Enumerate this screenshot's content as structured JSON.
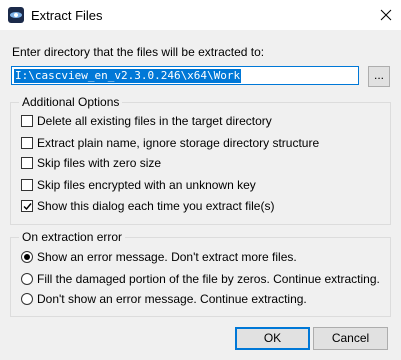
{
  "window": {
    "title": "Extract Files",
    "icon": "cascview-app-icon",
    "close_icon": "close-icon"
  },
  "directory": {
    "label": "Enter directory that the files will be extracted to:",
    "value": "I:\\cascview_en_v2.3.0.246\\x64\\Work",
    "browse_label": "..."
  },
  "additional_options": {
    "title": "Additional Options",
    "items": [
      {
        "label": "Delete all existing files in the target directory",
        "checked": false
      },
      {
        "label": "Extract plain name, ignore storage directory structure",
        "checked": false
      },
      {
        "label": "Skip files with zero size",
        "checked": false
      },
      {
        "label": "Skip files encrypted with an unknown key",
        "checked": false
      },
      {
        "label": "Show this dialog each time you extract file(s)",
        "checked": true
      }
    ]
  },
  "on_error": {
    "title": "On extraction error",
    "items": [
      {
        "label": "Show an error message. Don't extract more files.",
        "selected": true
      },
      {
        "label": "Fill the damaged portion of the file by zeros. Continue extracting.",
        "selected": false
      },
      {
        "label": "Don't show an error message. Continue extracting.",
        "selected": false
      }
    ]
  },
  "buttons": {
    "ok": "OK",
    "cancel": "Cancel"
  },
  "colors": {
    "accent": "#0078d7",
    "background": "#f0f0f0"
  }
}
